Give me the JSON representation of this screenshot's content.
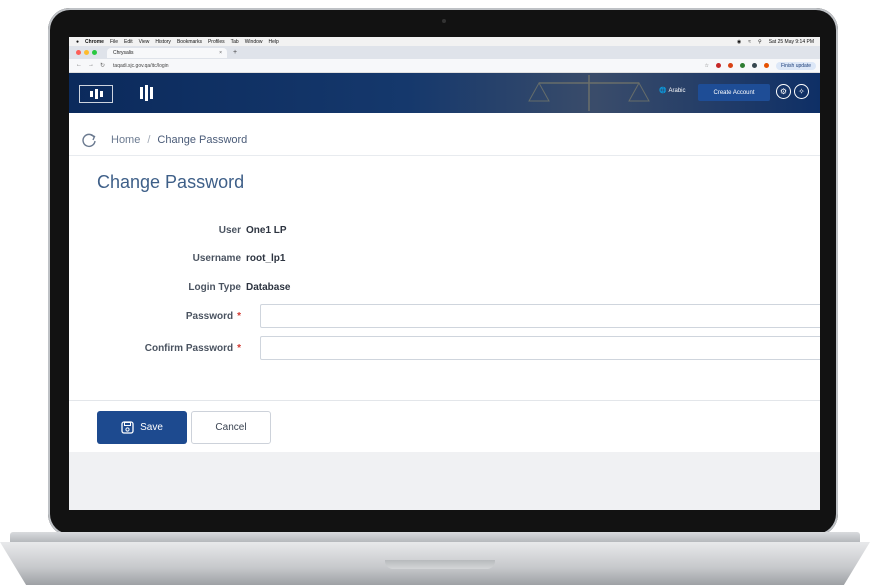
{
  "menubar": {
    "apple": "",
    "app": "Chrome",
    "items": [
      "File",
      "Edit",
      "View",
      "History",
      "Bookmarks",
      "Profiles",
      "Tab",
      "Window",
      "Help"
    ],
    "datetime": "Sat 25 May 9:14 PM"
  },
  "browser": {
    "tab_title": "Chrysalis",
    "tab_close": "×",
    "new_tab": "+",
    "url": "taqadi.sjc.gov.qa/itc/login",
    "finish_update": "Finish update"
  },
  "header": {
    "language": "Arabic",
    "create_account": "Create Account"
  },
  "breadcrumb": {
    "home": "Home",
    "separator": "/",
    "current": "Change Password"
  },
  "page": {
    "title": "Change Password"
  },
  "form": {
    "user_label": "User",
    "user_value": "One1 LP",
    "username_label": "Username",
    "username_value": "root_lp1",
    "login_type_label": "Login Type",
    "login_type_value": "Database",
    "password_label": "Password",
    "password_value": "",
    "confirm_password_label": "Confirm Password",
    "confirm_password_value": "",
    "required_mark": "*"
  },
  "actions": {
    "save": "Save",
    "cancel": "Cancel"
  },
  "colors": {
    "primary": "#1d4a8f",
    "header_bg": "#0b2a5c",
    "title": "#3e5f88",
    "required": "#d33a32"
  },
  "icons": [
    "apple-icon",
    "refresh-icon",
    "globe-icon",
    "save-icon",
    "settings-icon",
    "accessibility-icon"
  ]
}
